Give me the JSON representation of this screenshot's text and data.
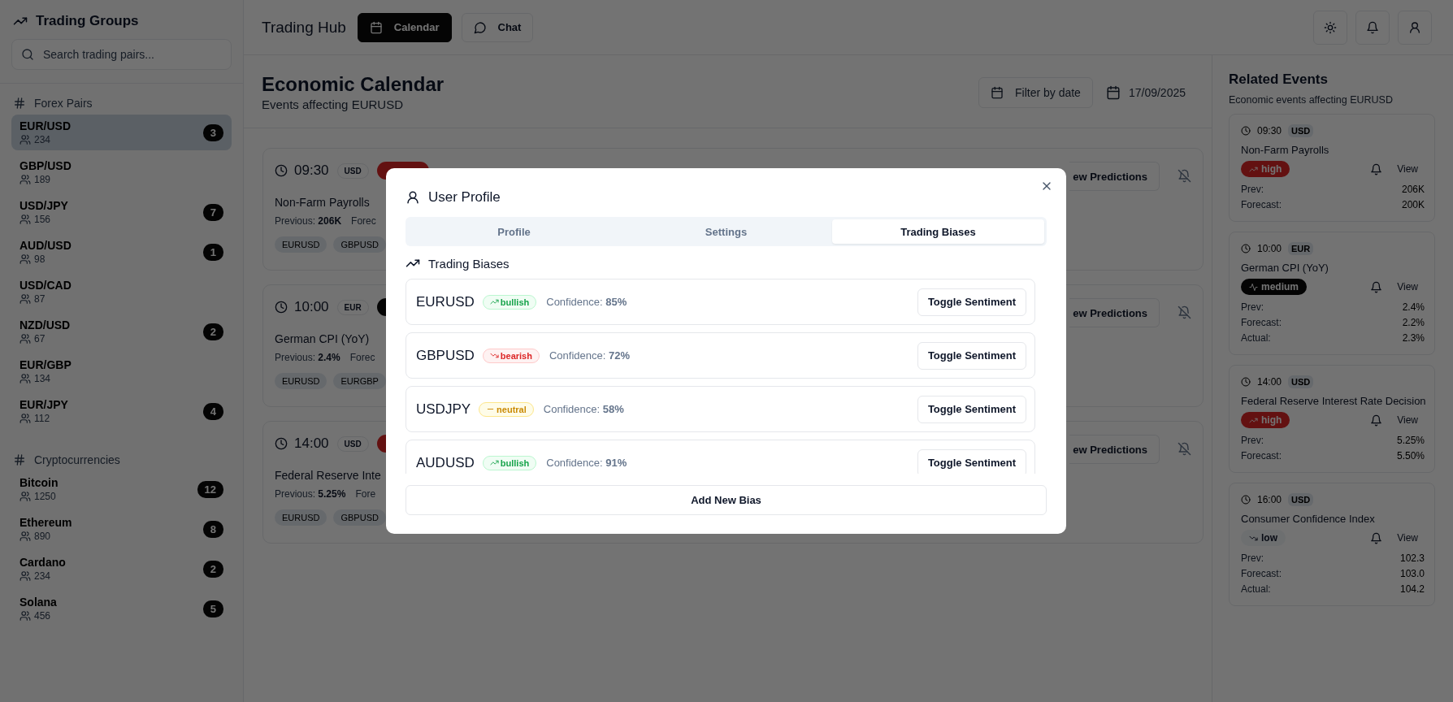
{
  "sidebar": {
    "title": "Trading Groups",
    "search": {
      "placeholder": "Search trading pairs..."
    },
    "groups": [
      {
        "title": "Forex Pairs",
        "items": [
          {
            "name": "EUR/USD",
            "members": "234",
            "count": "3",
            "selected": true
          },
          {
            "name": "GBP/USD",
            "members": "189",
            "selected": false
          },
          {
            "name": "USD/JPY",
            "members": "156",
            "count": "7",
            "selected": false
          },
          {
            "name": "AUD/USD",
            "members": "98",
            "count": "1",
            "selected": false
          },
          {
            "name": "USD/CAD",
            "members": "87",
            "selected": false
          },
          {
            "name": "NZD/USD",
            "members": "67",
            "count": "2",
            "selected": false
          },
          {
            "name": "EUR/GBP",
            "members": "134",
            "selected": false
          },
          {
            "name": "EUR/JPY",
            "members": "112",
            "count": "4",
            "selected": false
          }
        ]
      },
      {
        "title": "Cryptocurrencies",
        "items": [
          {
            "name": "Bitcoin",
            "members": "1250",
            "count": "12",
            "selected": false
          },
          {
            "name": "Ethereum",
            "members": "890",
            "count": "8",
            "selected": false
          },
          {
            "name": "Cardano",
            "members": "234",
            "count": "2",
            "selected": false
          },
          {
            "name": "Solana",
            "members": "456",
            "count": "5",
            "selected": false
          }
        ]
      }
    ]
  },
  "topbar": {
    "title": "Trading Hub",
    "tabs": [
      {
        "label": "Calendar",
        "kind": "calendar",
        "selected": true
      },
      {
        "label": "Chat",
        "kind": "chat",
        "selected": false
      }
    ]
  },
  "calendar": {
    "title": "Economic Calendar",
    "subtitle": "Events affecting EURUSD",
    "filter_button": "Filter by date",
    "date": "17/09/2025",
    "events": [
      {
        "time": "09:30",
        "currency": "USD",
        "color": "#631111",
        "title": "Non-Farm Payrolls",
        "previous": "Previous: **206K**",
        "forecast": "Forec",
        "tags": [
          "EURUSD",
          "GBPUSD"
        ],
        "predictions_button": "ew Predictions"
      },
      {
        "time": "10:00",
        "currency": "EUR",
        "color": "#050505",
        "title": "German CPI (YoY)",
        "previous": "Previous: **2.4%**",
        "forecast": "Forec",
        "tags": [
          "EURUSD",
          "EURGBP"
        ],
        "predictions_button": "ew Predictions"
      },
      {
        "time": "14:00",
        "currency": "USD",
        "color": "#631111",
        "title": "Federal Reserve Inte",
        "previous": "Previous: **5.25%**",
        "forecast": "Fore",
        "tags": [
          "EURUSD",
          "GBPUSD"
        ],
        "predictions_button": "ew Predictions"
      }
    ]
  },
  "related": {
    "title": "Related Events",
    "subtitle": "Economic events affecting EURUSD",
    "events": [
      {
        "time": "09:30",
        "currency": "USD",
        "title": "Non-Farm Payrolls",
        "impact": {
          "label": "high",
          "kind": "high"
        },
        "view": "View",
        "figures": [
          {
            "label": "Prev:",
            "value": "206K"
          },
          {
            "label": "Forecast:",
            "value": "200K"
          }
        ]
      },
      {
        "time": "10:00",
        "currency": "EUR",
        "title": "German CPI (YoY)",
        "impact": {
          "label": "medium",
          "kind": "medium"
        },
        "view": "View",
        "figures": [
          {
            "label": "Prev:",
            "value": "2.4%"
          },
          {
            "label": "Forecast:",
            "value": "2.2%"
          },
          {
            "label": "Actual:",
            "value": "2.3%"
          }
        ]
      },
      {
        "time": "14:00",
        "currency": "USD",
        "title": "Federal Reserve Interest Rate Decision",
        "impact": {
          "label": "high",
          "kind": "high"
        },
        "view": "View",
        "figures": [
          {
            "label": "Prev:",
            "value": "5.25%"
          },
          {
            "label": "Forecast:",
            "value": "5.50%"
          }
        ]
      },
      {
        "time": "16:00",
        "currency": "USD",
        "title": "Consumer Confidence Index",
        "impact": {
          "label": "low",
          "kind": "low"
        },
        "view": "View",
        "figures": [
          {
            "label": "Prev:",
            "value": "102.3"
          },
          {
            "label": "Forecast:",
            "value": "103.0"
          },
          {
            "label": "Actual:",
            "value": "104.2"
          }
        ]
      }
    ]
  },
  "profile_modal": {
    "title": "User Profile",
    "tabs": [
      {
        "label": "Profile",
        "selected": false
      },
      {
        "label": "Settings",
        "selected": false
      },
      {
        "label": "Trading Biases",
        "selected": true
      }
    ],
    "section_title": "Trading Biases",
    "biases": [
      {
        "symbol": "EURUSD",
        "sentiment": {
          "label": "bullish",
          "kind": "bullish"
        },
        "confidence": "Confidence: **85%**",
        "button": "Toggle Sentiment"
      },
      {
        "symbol": "GBPUSD",
        "sentiment": {
          "label": "bearish",
          "kind": "bearish"
        },
        "confidence": "Confidence: **72%**",
        "button": "Toggle Sentiment"
      },
      {
        "symbol": "USDJPY",
        "sentiment": {
          "label": "neutral",
          "kind": "neutral"
        },
        "confidence": "Confidence: **58%**",
        "button": "Toggle Sentiment"
      },
      {
        "symbol": "AUDUSD",
        "sentiment": {
          "label": "bullish",
          "kind": "bullish"
        },
        "confidence": "Confidence: **91%**",
        "button": "Toggle Sentiment"
      }
    ],
    "add_button": "Add New Bias"
  }
}
